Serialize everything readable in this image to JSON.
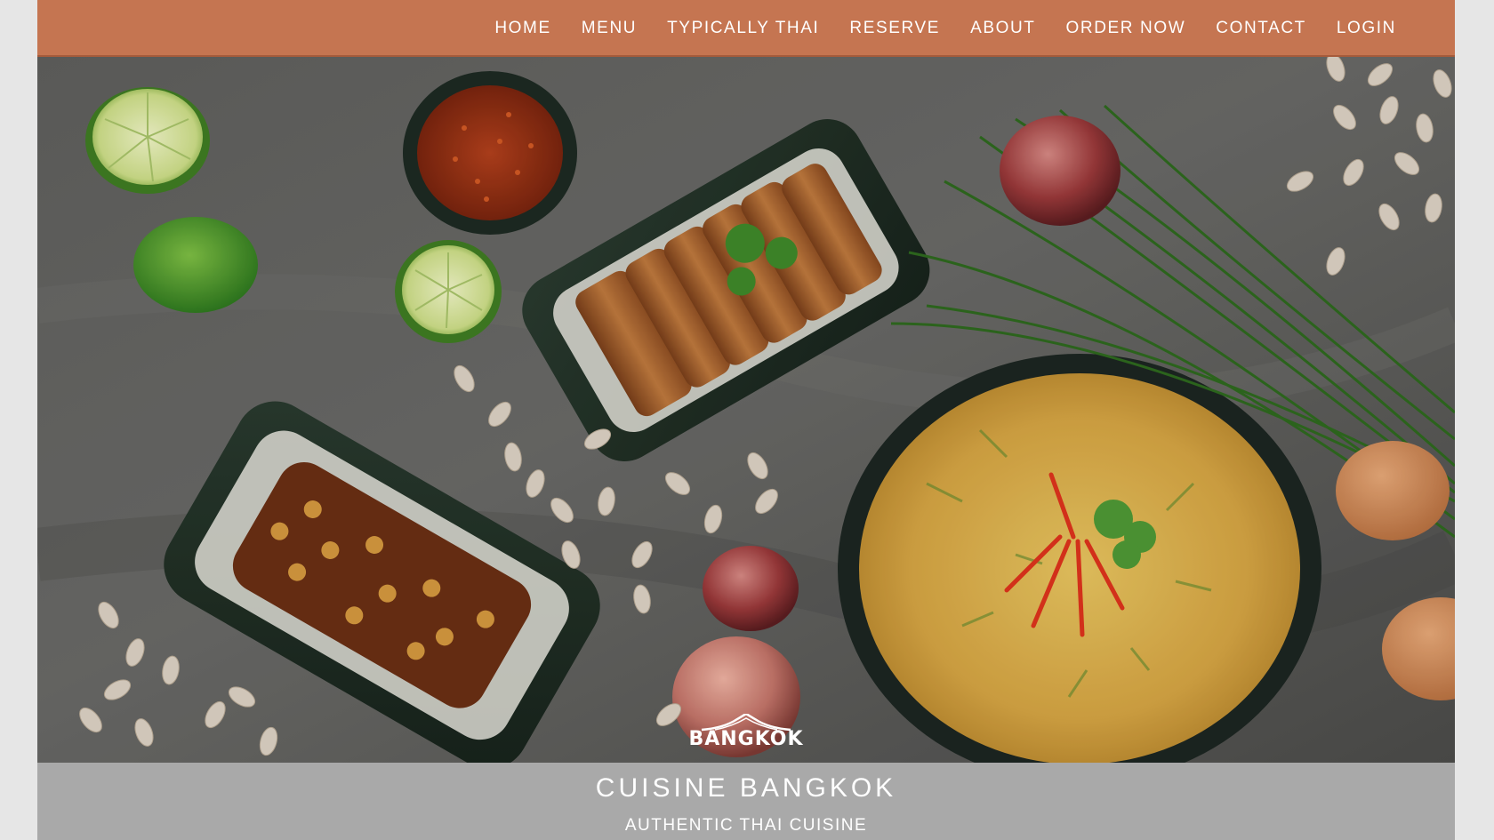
{
  "nav": {
    "items": [
      {
        "label": "HOME"
      },
      {
        "label": "MENU"
      },
      {
        "label": "TYPICALLY THAI"
      },
      {
        "label": "RESERVE"
      },
      {
        "label": "ABOUT"
      },
      {
        "label": "ORDER NOW"
      },
      {
        "label": "CONTACT"
      },
      {
        "label": "LOGIN"
      }
    ]
  },
  "hero": {
    "logo_text": "BANGKOK"
  },
  "caption": {
    "title": "CUISINE BANGKOK",
    "subtitle": "AUTHENTIC THAI CUISINE"
  },
  "colors": {
    "navbar": "#c57551",
    "caption_bar": "#a9a9a9",
    "page_background": "#e6e6e6",
    "text": "#ffffff"
  }
}
